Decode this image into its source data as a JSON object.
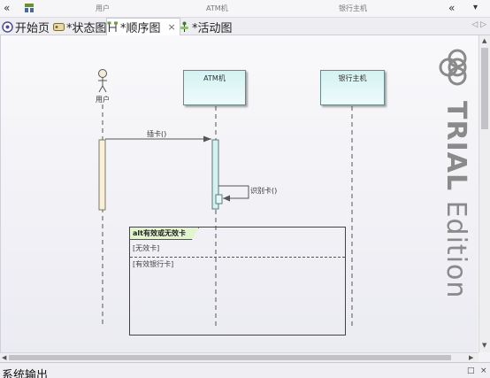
{
  "toolbar": {
    "left_chevron": "«",
    "right_chevron": "«",
    "right_arrow": "▾",
    "lifeline_headers": [
      "用户",
      "ATM机",
      "银行主机"
    ]
  },
  "tabs": [
    {
      "label": "开始页",
      "icon": "home-icon",
      "active": false
    },
    {
      "label": "*状态图",
      "icon": "state-diagram-icon",
      "active": false
    },
    {
      "label": "*顺序图",
      "icon": "sequence-diagram-icon",
      "active": true
    },
    {
      "label": "*活动图",
      "icon": "activity-diagram-icon",
      "active": false
    }
  ],
  "tab_close": "×",
  "tab_nav": "◁ ▷",
  "diagram": {
    "actor_label": "用户",
    "lifelines": [
      "ATM机",
      "银行主机"
    ],
    "message_insert_card": "插卡()",
    "message_identify_card": "识别卡()",
    "alt_frame": {
      "title": "alt有效或无效卡",
      "guard_1": "[无效卡]",
      "guard_2": "[有效银行卡]"
    }
  },
  "watermark": {
    "brand": "TRIAL",
    "edition": " Edition"
  },
  "scrollbar": {
    "up": "▲",
    "down": "▼",
    "left": "◀",
    "right": "▶"
  },
  "bottom_panel": {
    "title": "系统输出",
    "float_button": "□",
    "close_button": "×"
  }
}
